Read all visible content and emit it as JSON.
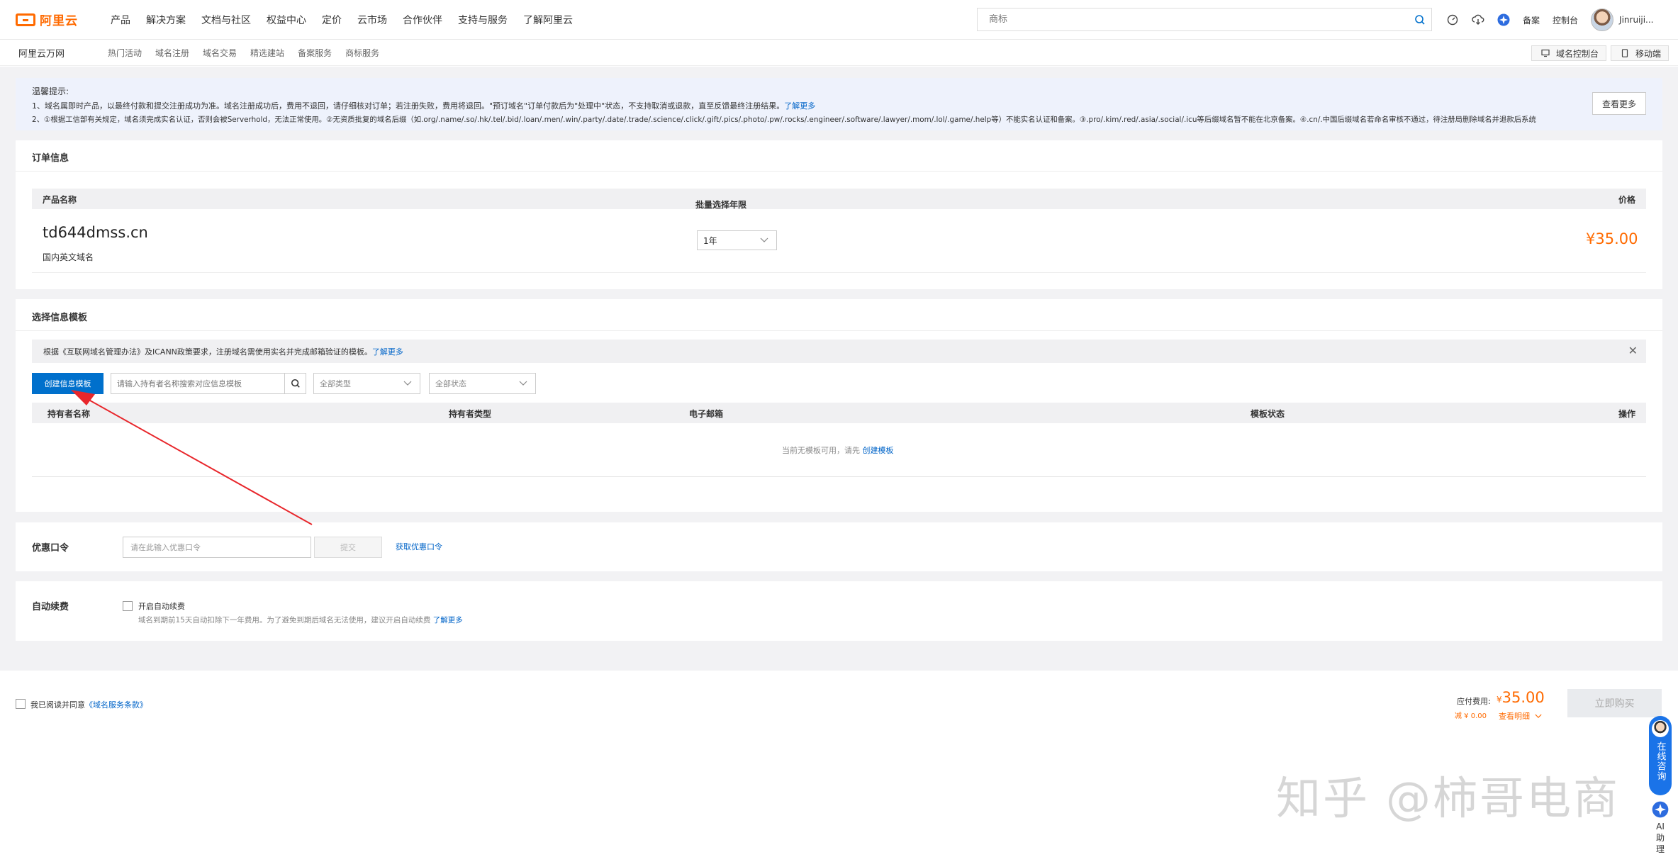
{
  "topnav": {
    "logo_text": "阿里云",
    "items": [
      "产品",
      "解决方案",
      "文档与社区",
      "权益中心",
      "定价",
      "云市场",
      "合作伙伴",
      "支持与服务",
      "了解阿里云"
    ],
    "search_placeholder": "商标",
    "right": {
      "beian": "备案",
      "console": "控制台",
      "user": "Jinruiji..."
    }
  },
  "subnav": {
    "brand": "阿里云万网",
    "items": [
      "热门活动",
      "域名注册",
      "域名交易",
      "精选建站",
      "备案服务",
      "商标服务"
    ],
    "domain_console": "域名控制台",
    "mobile": "移动端"
  },
  "notice": {
    "title": "温馨提示:",
    "line1": "1、域名属即时产品，以最终付款和提交注册成功为准。域名注册成功后，费用不退回，请仔细核对订单；若注册失败，费用将退回。\"预订域名\"订单付款后为\"处理中\"状态，不支持取消或退款，直至反馈最终注册结果。",
    "line1_link": "了解更多",
    "line2": "2、①根据工信部有关规定，域名须完成实名认证，否则会被Serverhold，无法正常使用。②无资质批复的域名后缀（如.org/.name/.so/.hk/.tel/.bid/.loan/.men/.win/.party/.date/.trade/.science/.click/.gift/.pics/.photo/.pw/.rocks/.engineer/.software/.lawyer/.mom/.lol/.game/.help等）不能实名认证和备案。③.pro/.kim/.red/.asia/.social/.icu等后缀域名暂不能在北京备案。④.cn/.中国后缀域名若命名审核不通过，待注册局删除域名并退款后系统",
    "more_button": "查看更多"
  },
  "order": {
    "title": "订单信息",
    "col_product": "产品名称",
    "col_years": "批量选择年限",
    "col_price": "价格",
    "domain": "td644dmss.cn",
    "domain_type": "国内英文域名",
    "years": "1年",
    "price": "¥35.00"
  },
  "template": {
    "title": "选择信息模板",
    "info": "根据《互联网域名管理办法》及ICANN政策要求，注册域名需使用实名并完成邮箱验证的模板。",
    "info_link": "了解更多",
    "create_button": "创建信息模板",
    "search_placeholder": "请输入持有者名称搜索对应信息模板",
    "type_filter": "全部类型",
    "status_filter": "全部状态",
    "columns": [
      "持有者名称",
      "持有者类型",
      "电子邮箱",
      "模板状态",
      "操作"
    ],
    "empty_text": "当前无模板可用，请先",
    "empty_link": "创建模板"
  },
  "coupon": {
    "title": "优惠口令",
    "placeholder": "请在此输入优惠口令",
    "submit": "提交",
    "get_link": "获取优惠口令"
  },
  "autorenew": {
    "title": "自动续费",
    "checkbox_label": "开启自动续费",
    "desc": "域名到期前15天自动扣除下一年费用。为了避免到期后域名无法使用，建议开启自动续费",
    "link": "了解更多"
  },
  "footer": {
    "agree_text": "我已阅读并同意",
    "agree_link": "《域名服务条款》",
    "payable_label": "应付费用:",
    "currency": "¥",
    "payable": "35.00",
    "discount": "减 ¥ 0.00",
    "detail": "查看明细",
    "buy": "立即购买"
  },
  "float": {
    "consult": "在线咨询",
    "ai": "AI助理"
  },
  "watermark": "知乎 @柿哥电商",
  "colors": {
    "accent": "#ff6a00",
    "primary": "#0070cc",
    "link": "#0064c8",
    "arrow": "#e8262b"
  }
}
